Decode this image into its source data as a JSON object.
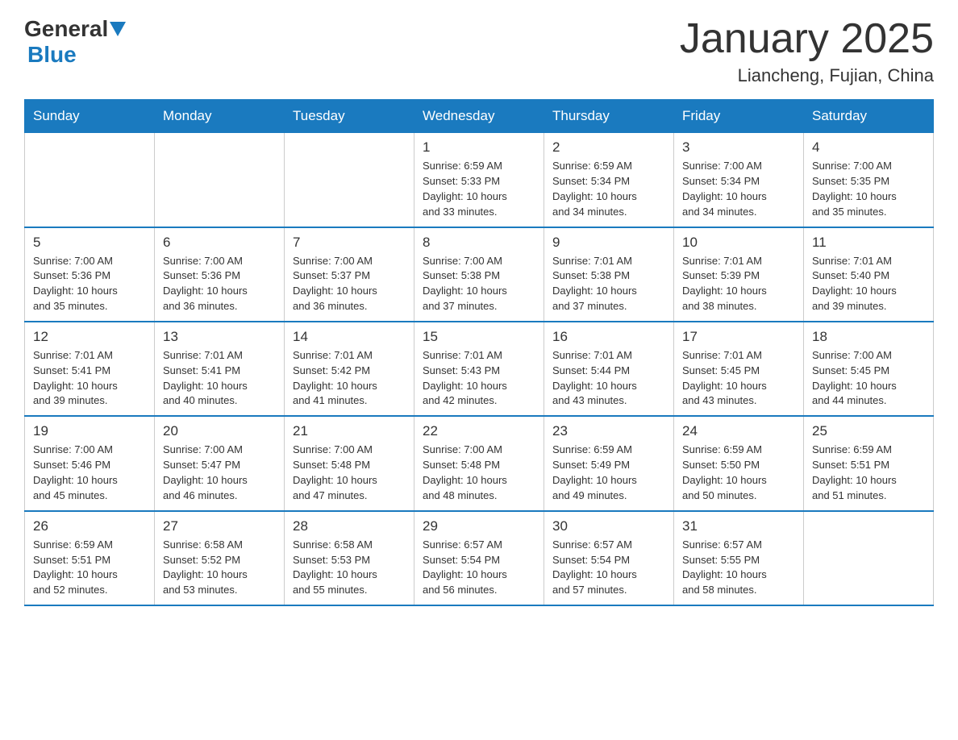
{
  "header": {
    "logo_general": "General",
    "logo_blue": "Blue",
    "title": "January 2025",
    "subtitle": "Liancheng, Fujian, China"
  },
  "days_of_week": [
    "Sunday",
    "Monday",
    "Tuesday",
    "Wednesday",
    "Thursday",
    "Friday",
    "Saturday"
  ],
  "weeks": [
    [
      {
        "day": "",
        "info": ""
      },
      {
        "day": "",
        "info": ""
      },
      {
        "day": "",
        "info": ""
      },
      {
        "day": "1",
        "info": "Sunrise: 6:59 AM\nSunset: 5:33 PM\nDaylight: 10 hours\nand 33 minutes."
      },
      {
        "day": "2",
        "info": "Sunrise: 6:59 AM\nSunset: 5:34 PM\nDaylight: 10 hours\nand 34 minutes."
      },
      {
        "day": "3",
        "info": "Sunrise: 7:00 AM\nSunset: 5:34 PM\nDaylight: 10 hours\nand 34 minutes."
      },
      {
        "day": "4",
        "info": "Sunrise: 7:00 AM\nSunset: 5:35 PM\nDaylight: 10 hours\nand 35 minutes."
      }
    ],
    [
      {
        "day": "5",
        "info": "Sunrise: 7:00 AM\nSunset: 5:36 PM\nDaylight: 10 hours\nand 35 minutes."
      },
      {
        "day": "6",
        "info": "Sunrise: 7:00 AM\nSunset: 5:36 PM\nDaylight: 10 hours\nand 36 minutes."
      },
      {
        "day": "7",
        "info": "Sunrise: 7:00 AM\nSunset: 5:37 PM\nDaylight: 10 hours\nand 36 minutes."
      },
      {
        "day": "8",
        "info": "Sunrise: 7:00 AM\nSunset: 5:38 PM\nDaylight: 10 hours\nand 37 minutes."
      },
      {
        "day": "9",
        "info": "Sunrise: 7:01 AM\nSunset: 5:38 PM\nDaylight: 10 hours\nand 37 minutes."
      },
      {
        "day": "10",
        "info": "Sunrise: 7:01 AM\nSunset: 5:39 PM\nDaylight: 10 hours\nand 38 minutes."
      },
      {
        "day": "11",
        "info": "Sunrise: 7:01 AM\nSunset: 5:40 PM\nDaylight: 10 hours\nand 39 minutes."
      }
    ],
    [
      {
        "day": "12",
        "info": "Sunrise: 7:01 AM\nSunset: 5:41 PM\nDaylight: 10 hours\nand 39 minutes."
      },
      {
        "day": "13",
        "info": "Sunrise: 7:01 AM\nSunset: 5:41 PM\nDaylight: 10 hours\nand 40 minutes."
      },
      {
        "day": "14",
        "info": "Sunrise: 7:01 AM\nSunset: 5:42 PM\nDaylight: 10 hours\nand 41 minutes."
      },
      {
        "day": "15",
        "info": "Sunrise: 7:01 AM\nSunset: 5:43 PM\nDaylight: 10 hours\nand 42 minutes."
      },
      {
        "day": "16",
        "info": "Sunrise: 7:01 AM\nSunset: 5:44 PM\nDaylight: 10 hours\nand 43 minutes."
      },
      {
        "day": "17",
        "info": "Sunrise: 7:01 AM\nSunset: 5:45 PM\nDaylight: 10 hours\nand 43 minutes."
      },
      {
        "day": "18",
        "info": "Sunrise: 7:00 AM\nSunset: 5:45 PM\nDaylight: 10 hours\nand 44 minutes."
      }
    ],
    [
      {
        "day": "19",
        "info": "Sunrise: 7:00 AM\nSunset: 5:46 PM\nDaylight: 10 hours\nand 45 minutes."
      },
      {
        "day": "20",
        "info": "Sunrise: 7:00 AM\nSunset: 5:47 PM\nDaylight: 10 hours\nand 46 minutes."
      },
      {
        "day": "21",
        "info": "Sunrise: 7:00 AM\nSunset: 5:48 PM\nDaylight: 10 hours\nand 47 minutes."
      },
      {
        "day": "22",
        "info": "Sunrise: 7:00 AM\nSunset: 5:48 PM\nDaylight: 10 hours\nand 48 minutes."
      },
      {
        "day": "23",
        "info": "Sunrise: 6:59 AM\nSunset: 5:49 PM\nDaylight: 10 hours\nand 49 minutes."
      },
      {
        "day": "24",
        "info": "Sunrise: 6:59 AM\nSunset: 5:50 PM\nDaylight: 10 hours\nand 50 minutes."
      },
      {
        "day": "25",
        "info": "Sunrise: 6:59 AM\nSunset: 5:51 PM\nDaylight: 10 hours\nand 51 minutes."
      }
    ],
    [
      {
        "day": "26",
        "info": "Sunrise: 6:59 AM\nSunset: 5:51 PM\nDaylight: 10 hours\nand 52 minutes."
      },
      {
        "day": "27",
        "info": "Sunrise: 6:58 AM\nSunset: 5:52 PM\nDaylight: 10 hours\nand 53 minutes."
      },
      {
        "day": "28",
        "info": "Sunrise: 6:58 AM\nSunset: 5:53 PM\nDaylight: 10 hours\nand 55 minutes."
      },
      {
        "day": "29",
        "info": "Sunrise: 6:57 AM\nSunset: 5:54 PM\nDaylight: 10 hours\nand 56 minutes."
      },
      {
        "day": "30",
        "info": "Sunrise: 6:57 AM\nSunset: 5:54 PM\nDaylight: 10 hours\nand 57 minutes."
      },
      {
        "day": "31",
        "info": "Sunrise: 6:57 AM\nSunset: 5:55 PM\nDaylight: 10 hours\nand 58 minutes."
      },
      {
        "day": "",
        "info": ""
      }
    ]
  ]
}
